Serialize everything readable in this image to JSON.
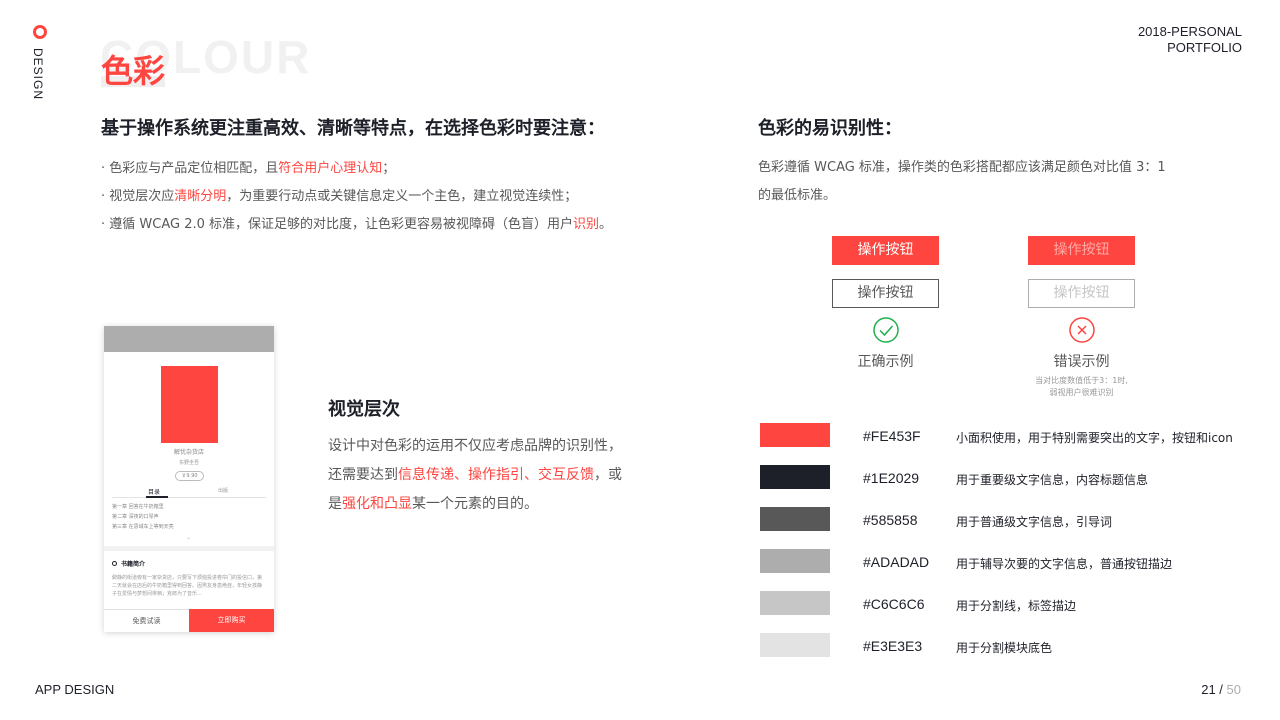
{
  "side_label": "DESIGN",
  "brand": {
    "line1": "2018-PERSONAL",
    "line2": "PORTFOLIO"
  },
  "title": {
    "ghost": "COLOUR",
    "main": "色彩"
  },
  "left": {
    "heading": "基于操作系统更注重高效、清晰等特点，在选择色彩时要注意：",
    "bullets": [
      {
        "pre": "· 色彩应与产品定位相匹配，且",
        "hl": "符合用户心理认知",
        "post": "；"
      },
      {
        "pre": "· 视觉层次应",
        "hl": "清晰分明",
        "post": "，为重要行动点或关键信息定义一个主色，建立视觉连续性；"
      },
      {
        "pre": "· 遵循 WCAG 2.0 标准，保证足够的对比度，让色彩更容易被视障碍（色盲）用户",
        "hl": "识别",
        "post": "。"
      }
    ]
  },
  "phone": {
    "store": "解忧杂货店",
    "author": "东野圭吾",
    "price": "￥9.90",
    "tab_a": "目录",
    "tab_b": "出版",
    "chapters": [
      "第一章  回答在牛奶箱里",
      "第二章  深夜的口琴声",
      "第三章  在思域车上等到天亮"
    ],
    "chevron": "⌄",
    "intro_title": "书籍简介",
    "intro_text": "僻静的街道旁有一家杂货店，只要写下烦恼投进卷帘门的投信口，第二天就会在店后的牛奶箱里得到回答。因男友身患绝症，年轻女孩静子在爱情与梦想间徘徊；克郎为了音乐...",
    "btn_trial": "免费试读",
    "btn_buy": "立即购买"
  },
  "visual": {
    "heading": "视觉层次",
    "line1": "设计中对色彩的运用不仅应考虑品牌的识别性，",
    "line2_pre": "还需要达到",
    "line2_hl": "信息传递、操作指引、交互反馈",
    "line2_post": "，或",
    "line3_pre": "是",
    "line3_hl": "强化和凸显",
    "line3_post": "某一个元素的目的。"
  },
  "right": {
    "heading": "色彩的易识别性：",
    "line1": "色彩遵循 WCAG 标准，操作类的色彩搭配都应该满足颜色对比值 3：1",
    "line2": "的最低标准。"
  },
  "examples": {
    "button_label": "操作按钮",
    "correct_label": "正确示例",
    "wrong_label": "错误示例",
    "wrong_note_1": "当对比度数值低于3：1时,",
    "wrong_note_2": "弱视用户很难识别"
  },
  "palette": [
    {
      "color": "#FE453F",
      "hex": "#FE453F",
      "usage": "小面积使用，用于特别需要突出的文字，按钮和icon"
    },
    {
      "color": "#1E2029",
      "hex": "#1E2029",
      "usage": "用于重要级文字信息，内容标题信息"
    },
    {
      "color": "#585858",
      "hex": "#585858",
      "usage": "用于普通级文字信息，引导词"
    },
    {
      "color": "#ADADAD",
      "hex": "#ADADAD",
      "usage": "用于辅导次要的文字信息，普通按钮描边"
    },
    {
      "color": "#C6C6C6",
      "hex": "#C6C6C6",
      "usage": "用于分割线，标签描边"
    },
    {
      "color": "#E3E3E3",
      "hex": "#E3E3E3",
      "usage": "用于分割模块底色"
    }
  ],
  "colors": {
    "accent": "#FE453F",
    "success": "#22B14C"
  },
  "footer": {
    "left": "APP DESIGN",
    "page_current": "21",
    "page_sep": " / ",
    "page_total": "50"
  }
}
